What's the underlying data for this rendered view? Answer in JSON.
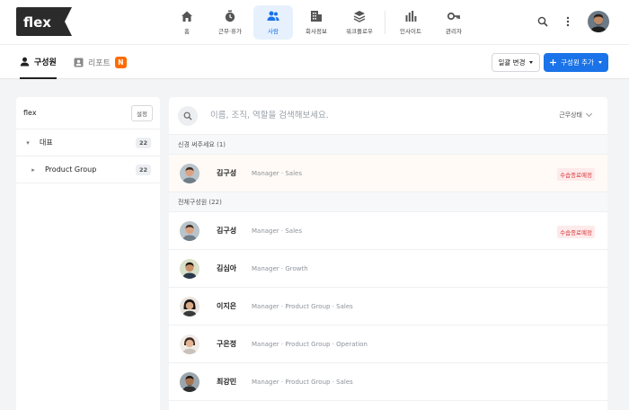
{
  "app": {
    "logo_text": "flex"
  },
  "colors": {
    "brand_dark": "#2b2b2b",
    "accent": "#1a73e8",
    "report_badge": "#ff6b00",
    "status_red": "#d9383d"
  },
  "nav": {
    "items": [
      {
        "label": "홈",
        "icon": "home-icon"
      },
      {
        "label": "근무·휴가",
        "icon": "timer-icon"
      },
      {
        "label": "사람",
        "icon": "people-icon",
        "active": true
      },
      {
        "label": "회사정보",
        "icon": "building-icon"
      },
      {
        "label": "워크플로우",
        "icon": "layers-icon"
      },
      {
        "label": "인사이트",
        "icon": "bar-chart-icon"
      },
      {
        "label": "관리자",
        "icon": "key-icon"
      }
    ]
  },
  "subnav": {
    "tabs": [
      {
        "label": "구성원",
        "icon": "person-icon",
        "active": true
      },
      {
        "label": "리포트",
        "icon": "id-card-icon",
        "badge": "N"
      }
    ],
    "bulk_edit_label": "일괄 변경",
    "add_member_label": "구성원 추가"
  },
  "org_panel": {
    "org_name": "flex",
    "settings_label": "설정",
    "tree": [
      {
        "label": "대표",
        "count": "22",
        "expanded": true
      },
      {
        "label": "Product Group",
        "count": "22",
        "expanded": false
      }
    ]
  },
  "members_panel": {
    "search_placeholder": "이름, 조직, 역할을 검색해보세요.",
    "status_filter_label": "근무상태",
    "new_section_label": "신경 써주세요 (1)",
    "all_section_label": "전체구성원 (22)",
    "attention_members": [
      {
        "name": "김구성",
        "role": "Manager · Sales",
        "status": "수습종료예정"
      }
    ],
    "all_members": [
      {
        "name": "김구성",
        "role": "Manager · Sales",
        "status": "수습종료예정"
      },
      {
        "name": "김심아",
        "role": "Manager · Growth",
        "status": ""
      },
      {
        "name": "이지은",
        "role": "Manager · Product Group · Sales",
        "status": ""
      },
      {
        "name": "구은정",
        "role": "Manager · Product Group · Operation",
        "status": ""
      },
      {
        "name": "최강민",
        "role": "Manager · Product Group · Sales",
        "status": ""
      }
    ]
  }
}
